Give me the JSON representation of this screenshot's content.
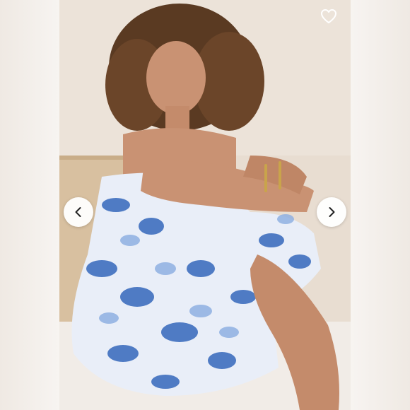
{
  "viewer": {
    "image_subject": "woman-in-blue-floral-smocked-dress",
    "colors": {
      "dress_blue": "#3f6fbf",
      "dress_light": "#e9eef8",
      "wall": "#e8ddd1",
      "wood": "#d8c0a0",
      "button_bg": "#ffffff",
      "icon": "#222222"
    }
  },
  "controls": {
    "prev_icon": "chevron-left-icon",
    "next_icon": "chevron-right-icon",
    "like_icon": "heart-outline-icon"
  }
}
